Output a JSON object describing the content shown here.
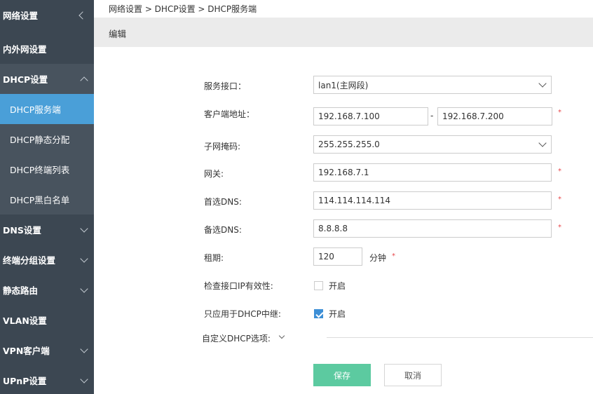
{
  "sidebar": {
    "section_title": "网络设置",
    "items": [
      {
        "label": "内外网设置"
      },
      {
        "label": "DHCP设置"
      },
      {
        "label": "DHCP服务端"
      },
      {
        "label": "DHCP静态分配"
      },
      {
        "label": "DHCP终端列表"
      },
      {
        "label": "DHCP黑白名单"
      },
      {
        "label": "DNS设置"
      },
      {
        "label": "终端分组设置"
      },
      {
        "label": "静态路由"
      },
      {
        "label": "VLAN设置"
      },
      {
        "label": "VPN客户端"
      },
      {
        "label": "UPnP设置"
      }
    ]
  },
  "breadcrumb": "网络设置 > DHCP设置 > DHCP服务端",
  "panel_title": "编辑",
  "form": {
    "interface": {
      "label": "服务接口：",
      "value": "lan1(主网段)"
    },
    "client_address": {
      "label": "客户端地址：",
      "start": "192.168.7.100",
      "separator": "-",
      "end": "192.168.7.200"
    },
    "subnet_mask": {
      "label": "子网掩码:",
      "value": "255.255.255.0"
    },
    "gateway": {
      "label": "网关:",
      "value": "192.168.7.1"
    },
    "primary_dns": {
      "label": "首选DNS:",
      "value": "114.114.114.114"
    },
    "secondary_dns": {
      "label": "备选DNS:",
      "value": "8.8.8.8"
    },
    "lease": {
      "label": "租期:",
      "value": "120",
      "unit": "分钟"
    },
    "check_ip": {
      "label": "检查接口IP有效性:",
      "option": "开启",
      "checked": false
    },
    "relay_only": {
      "label": "只应用于DHCP中继:",
      "option": "开启",
      "checked": true
    },
    "custom_options": {
      "label": "自定义DHCP选项:"
    },
    "required_mark": "*"
  },
  "buttons": {
    "save": "保存",
    "cancel": "取消"
  },
  "colors": {
    "sidebar_bg": "#3c4752",
    "active_item": "#4a9fd8",
    "save_button": "#5ccaa0",
    "required": "#e8474b",
    "checkbox": "#3d8fd6"
  }
}
